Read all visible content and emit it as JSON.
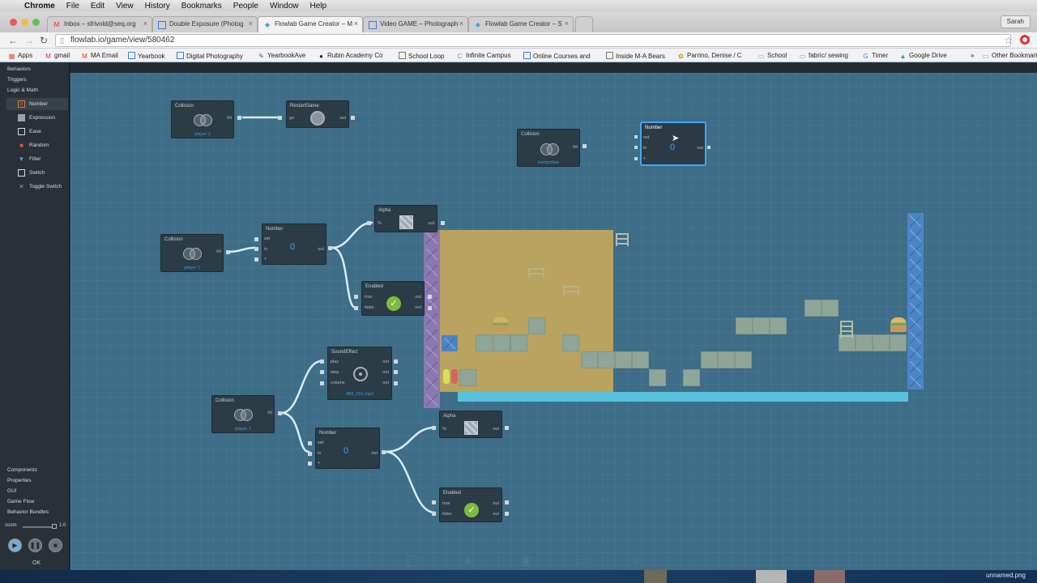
{
  "mac_menu": [
    "Chrome",
    "File",
    "Edit",
    "View",
    "History",
    "Bookmarks",
    "People",
    "Window",
    "Help"
  ],
  "browser": {
    "tabs": [
      {
        "label": "Inbox – sfrivold@seq.org",
        "icon": "gmail-icon",
        "active": false
      },
      {
        "label": "Double Exposure (Photog",
        "icon": "doc-icon",
        "active": false
      },
      {
        "label": "Flowlab Game Creator – M",
        "icon": "flowlab-icon",
        "active": true
      },
      {
        "label": "Video GAME – Photograph",
        "icon": "doc-icon",
        "active": false
      },
      {
        "label": "Flowlab Game Creator – S",
        "icon": "flowlab-icon",
        "active": false
      }
    ],
    "close_glyph": "×",
    "user": "Sarah",
    "url": "flowlab.io/game/view/580462",
    "bookmarks": [
      {
        "label": "Apps",
        "icon": "apps-icon"
      },
      {
        "label": "gmail",
        "icon": "gmail-icon"
      },
      {
        "label": "MA Email",
        "icon": "gmail-icon"
      },
      {
        "label": "Yearbook",
        "icon": "page-icon"
      },
      {
        "label": "Digital Photography",
        "icon": "page-icon"
      },
      {
        "label": "YearbookAve",
        "icon": "page-icon"
      },
      {
        "label": "Rubin Academy Co",
        "icon": "page-icon"
      },
      {
        "label": "School Loop",
        "icon": "page-icon"
      },
      {
        "label": "Infinite Campus",
        "icon": "page-icon"
      },
      {
        "label": "Online Courses and",
        "icon": "page-icon"
      },
      {
        "label": "Inside M-A Bears",
        "icon": "page-icon"
      },
      {
        "label": "Parrino, Denise / C",
        "icon": "page-icon"
      },
      {
        "label": "School",
        "icon": "folder-icon"
      },
      {
        "label": "fabric/ sewing",
        "icon": "folder-icon"
      },
      {
        "label": "Timer",
        "icon": "google-icon"
      },
      {
        "label": "Google Drive",
        "icon": "drive-icon"
      },
      {
        "label": "»",
        "icon": ""
      },
      {
        "label": "Other Bookmarks",
        "icon": "folder-icon"
      }
    ]
  },
  "sidebar": {
    "top_sections": [
      "Behaviors",
      "Triggers",
      "Logic & Math"
    ],
    "items": [
      {
        "label": "Number",
        "icon": "number-icon",
        "color": "#d9773b"
      },
      {
        "label": "Expression",
        "icon": "expression-icon",
        "color": "#9aa3a9"
      },
      {
        "label": "Ease",
        "icon": "ease-icon",
        "color": "#d6dbe0"
      },
      {
        "label": "Random",
        "icon": "dice-icon",
        "color": "#e04b4b"
      },
      {
        "label": "Filter",
        "icon": "filter-icon",
        "color": "#4aa3df"
      },
      {
        "label": "Switch",
        "icon": "switch-icon",
        "color": "#d6dbe0"
      },
      {
        "label": "Toggle Switch",
        "icon": "toggle-icon",
        "color": "#7dbb3f"
      }
    ],
    "bottom_sections": [
      "Components",
      "Properties",
      "GUI",
      "Game Flow",
      "Behavior Bundles"
    ],
    "zoom_label": "zoom",
    "zoom_value": "1.0",
    "ok_label": "OK"
  },
  "nodes": {
    "collision1": {
      "title": "Collision",
      "sub": "player 1",
      "out": "hit"
    },
    "restart": {
      "title": "RestartGame",
      "in": "go",
      "out": "out"
    },
    "collision_top": {
      "title": "Collision",
      "sub": "trampoline",
      "out": "hit"
    },
    "number_selected": {
      "title": "Number",
      "ports": [
        "set",
        "in",
        "+"
      ],
      "value": "0",
      "out": "out"
    },
    "collision2": {
      "title": "Collision",
      "sub": "player 1",
      "out": "hit"
    },
    "number2": {
      "title": "Number",
      "ports": [
        "set",
        "in",
        "+"
      ],
      "value": "0",
      "out": "out"
    },
    "alpha1": {
      "title": "Alpha",
      "in": "%",
      "out": "out"
    },
    "enabled1": {
      "title": "Enabled",
      "ports": [
        "true",
        "false"
      ],
      "outs": [
        "out",
        "out"
      ]
    },
    "sound": {
      "title": "SoundEffect",
      "ports": [
        "play",
        "stop",
        "volume"
      ],
      "outs": [
        "out",
        "out",
        "out"
      ],
      "sub": "8Bit_001.mp3"
    },
    "collision3": {
      "title": "Collision",
      "sub": "player 1",
      "out": "hit"
    },
    "number3": {
      "title": "Number",
      "ports": [
        "set",
        "in",
        "+"
      ],
      "value": "0",
      "out": "out"
    },
    "alpha2": {
      "title": "Alpha",
      "in": "%",
      "out": "out"
    },
    "enabled2": {
      "title": "Enabled",
      "ports": [
        "true",
        "false"
      ],
      "outs": [
        "out",
        "out"
      ]
    }
  },
  "desktop": {
    "file_label": "unnamed.png"
  },
  "colors": {
    "canvas": "#3d6d87",
    "wire": "#cfe4ef",
    "accent": "#3fa9f5",
    "level_fill": "#b9a35e"
  }
}
